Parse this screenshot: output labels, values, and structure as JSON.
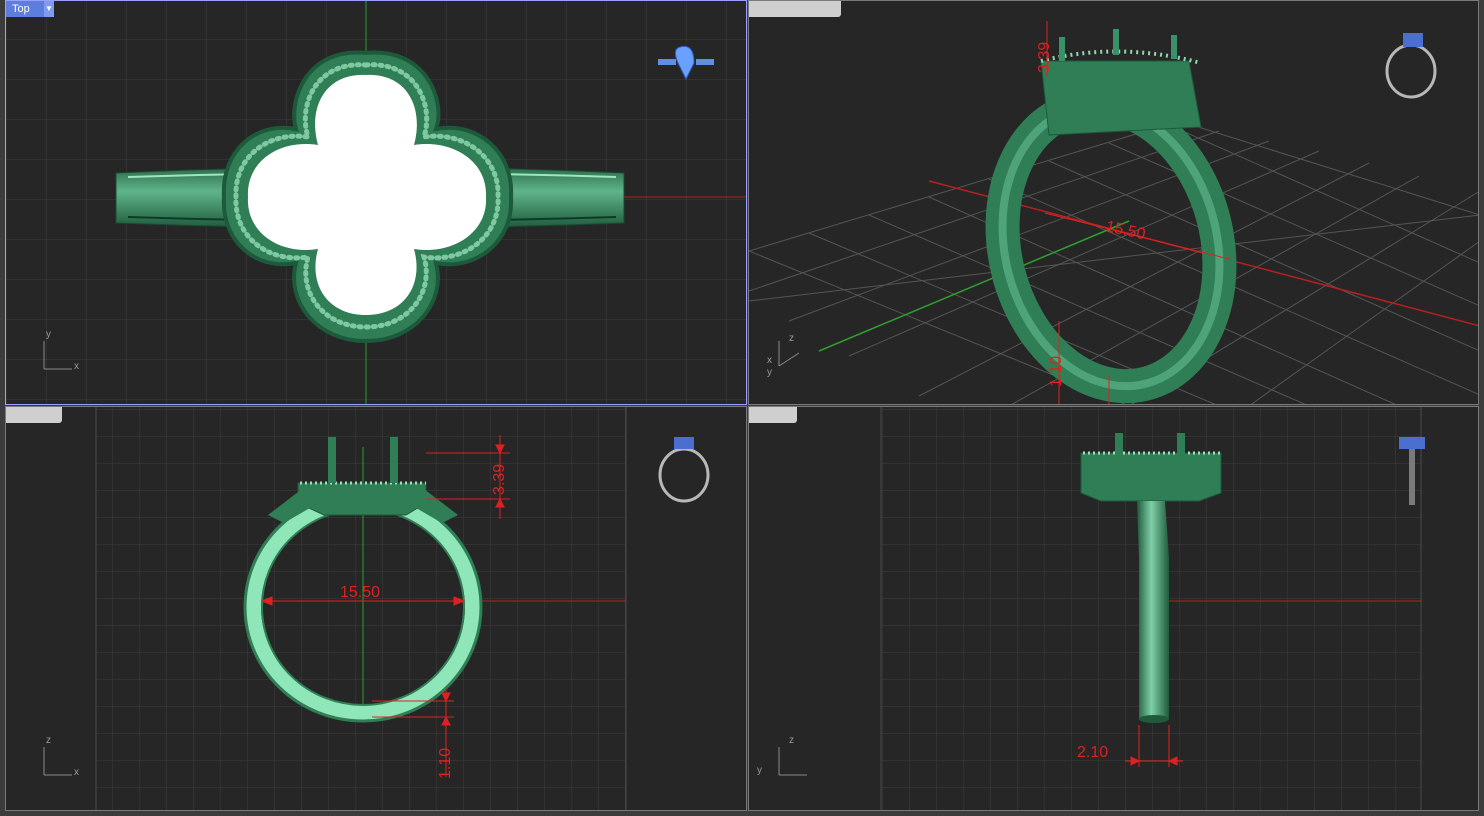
{
  "viewports": {
    "top": {
      "tab_label": "Top",
      "axis": {
        "v": "y",
        "h": "x"
      }
    },
    "perspective": {
      "tab_label": "",
      "dims": {
        "height": "3.39",
        "inner": "15.50",
        "shank": "1.10"
      },
      "axis": {
        "v": "z",
        "h": "x",
        "d": "y"
      }
    },
    "front": {
      "tab_label": "",
      "dims": {
        "height": "3.39",
        "inner": "15.50",
        "shank": "1.10"
      },
      "axis": {
        "v": "z",
        "h": "x"
      }
    },
    "right": {
      "tab_label": "",
      "dims": {
        "width": "2.10"
      },
      "axis": {
        "v": "z",
        "h": "y"
      }
    }
  },
  "colors": {
    "viewport_bg": "#262626",
    "grid": "#3e3e3e",
    "grid_major": "#555555",
    "x_axis": "#b82020",
    "y_axis": "#2da02d",
    "model": "#2f7e55",
    "model_light": "#8fe6b8",
    "dimension": "#e02020",
    "active_border": "#9aa0ff"
  }
}
